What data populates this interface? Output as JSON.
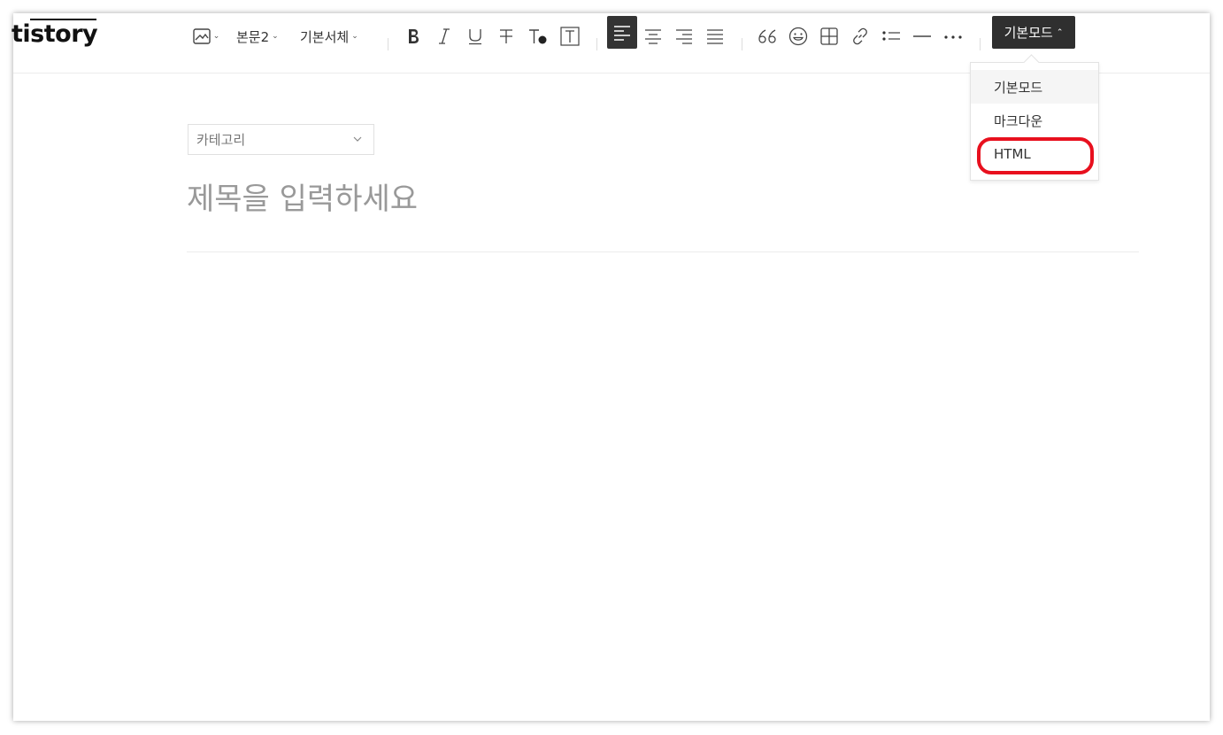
{
  "logo": "tistory",
  "toolbar": {
    "paragraph_style": "본문2",
    "font_family": "기본서체",
    "mode_button": "기본모드"
  },
  "mode_menu": {
    "items": [
      "기본모드",
      "마크다운",
      "HTML"
    ],
    "selected": "기본모드",
    "highlighted": "HTML"
  },
  "editor": {
    "category_placeholder": "카테고리",
    "title_placeholder": "제목을 입력하세요"
  },
  "icons": [
    "image-icon",
    "bold-icon",
    "italic-icon",
    "underline-icon",
    "strikethrough-icon",
    "text-color-icon",
    "text-background-icon",
    "align-left-icon",
    "align-center-icon",
    "align-right-icon",
    "align-justify-icon",
    "quote-icon",
    "emoji-icon",
    "table-icon",
    "link-icon",
    "list-icon",
    "divider-icon",
    "more-icon"
  ],
  "colors": {
    "active_button_bg": "#2f2f2f",
    "highlight_ring": "#e8101e"
  }
}
